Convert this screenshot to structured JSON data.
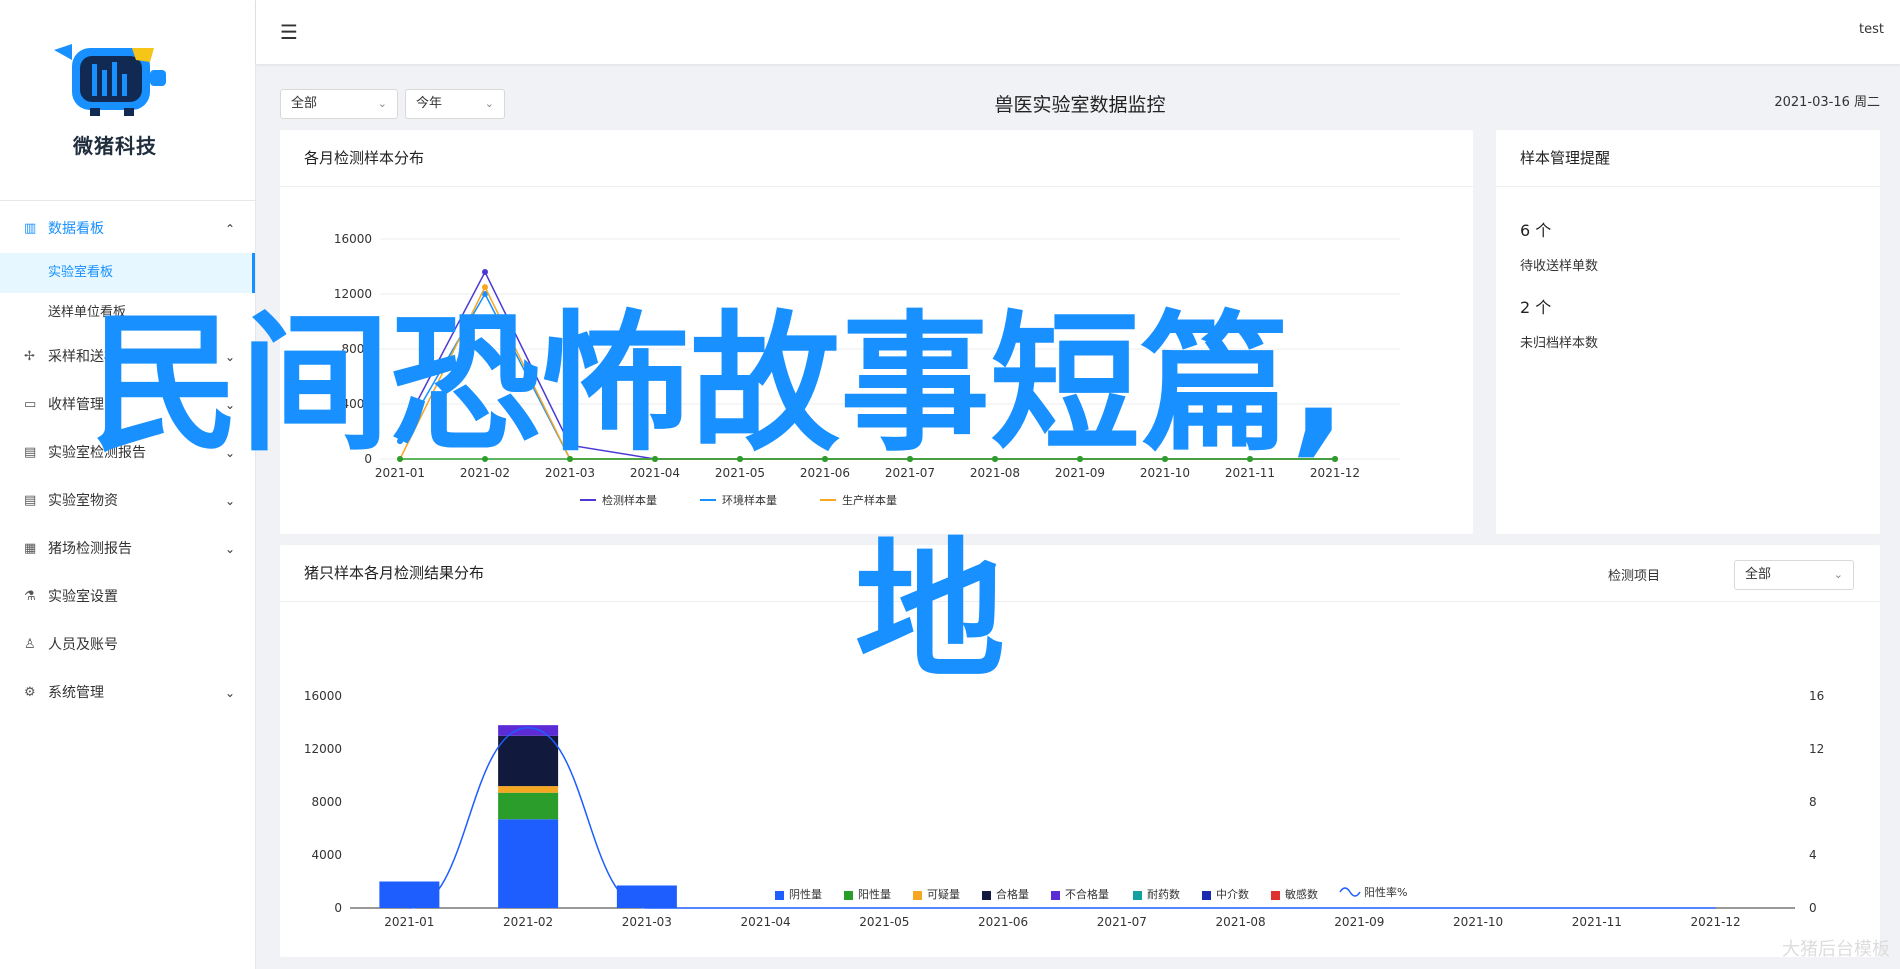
{
  "brand": {
    "name": "微猪科技",
    "colors": {
      "primary": "#1890ff",
      "dark": "#102a54",
      "yellow": "#f5c518"
    }
  },
  "sidebar": {
    "groups": [
      {
        "label": "数据看板",
        "icon": "bar-chart-icon",
        "open": true,
        "children": [
          {
            "label": "实验室看板",
            "active": true
          },
          {
            "label": "送样单位看板"
          }
        ]
      },
      {
        "label": "采样和送样",
        "icon": "sample-icon",
        "chevron": true
      },
      {
        "label": "收样管理",
        "icon": "inbox-icon",
        "chevron": true
      },
      {
        "label": "实验室检测报告",
        "icon": "report-icon",
        "chevron": true
      },
      {
        "label": "实验室物资",
        "icon": "supplies-icon",
        "chevron": true
      },
      {
        "label": "猪场检测报告",
        "icon": "farm-report-icon",
        "chevron": true
      },
      {
        "label": "实验室设置",
        "icon": "lab-settings-icon",
        "chevron": false
      },
      {
        "label": "人员及账号",
        "icon": "user-icon",
        "chevron": false
      },
      {
        "label": "系统管理",
        "icon": "gear-icon",
        "chevron": true
      }
    ]
  },
  "header": {
    "user": "test"
  },
  "toolbar": {
    "filter1": "全部",
    "filter2": "今年",
    "title": "兽医实验室数据监控",
    "date": "2021-03-16 周二"
  },
  "card_monthly": {
    "title": "各月检测样本分布"
  },
  "card_remind": {
    "title": "样本管理提醒",
    "items": [
      {
        "num": "6 个",
        "label": "待收送样单数"
      },
      {
        "num": "2 个",
        "label": "未归档样本数"
      }
    ]
  },
  "card_pig": {
    "title": "猪只样本各月检测结果分布",
    "filter_label": "检测项目",
    "filter_value": "全部"
  },
  "overlay": {
    "line1": "民间恐怖故事短篇,",
    "line2": "地"
  },
  "watermark": "大猪后台模板",
  "chart_data": [
    {
      "type": "line",
      "title": "各月检测样本分布",
      "x": [
        "2021-01",
        "2021-02",
        "2021-03",
        "2021-04",
        "2021-05",
        "2021-06",
        "2021-07",
        "2021-08",
        "2021-09",
        "2021-10",
        "2021-11",
        "2021-12"
      ],
      "ylim": [
        0,
        16000
      ],
      "yticks": [
        0,
        4000,
        8000,
        12000,
        16000
      ],
      "series": [
        {
          "name": "检测样本量",
          "color": "#4a3ad3",
          "values": [
            1800,
            13600,
            1000,
            0,
            0,
            0,
            0,
            0,
            0,
            0,
            0,
            0
          ]
        },
        {
          "name": "环境样本量",
          "color": "#1890ff",
          "values": [
            1300,
            12000,
            0,
            0,
            0,
            0,
            0,
            0,
            0,
            0,
            0,
            0
          ]
        },
        {
          "name": "生产样本量",
          "color": "#f5a623",
          "values": [
            0,
            12500,
            0,
            0,
            0,
            0,
            0,
            0,
            0,
            0,
            0,
            0
          ]
        },
        {
          "name": "",
          "color": "#2a9d2a",
          "values": [
            0,
            0,
            0,
            0,
            0,
            0,
            0,
            0,
            0,
            0,
            0,
            0
          ]
        }
      ]
    },
    {
      "type": "bar",
      "title": "猪只样本各月检测结果分布",
      "categories": [
        "2021-01",
        "2021-02",
        "2021-03",
        "2021-04",
        "2021-05",
        "2021-06",
        "2021-07",
        "2021-08",
        "2021-09",
        "2021-10",
        "2021-11",
        "2021-12"
      ],
      "ylim": [
        0,
        16000
      ],
      "yticks": [
        0,
        4000,
        8000,
        12000,
        16000
      ],
      "y2lim": [
        0,
        16
      ],
      "y2ticks": [
        0,
        4,
        8,
        12,
        16
      ],
      "stacked": true,
      "series": [
        {
          "name": "阴性量",
          "color": "#1e5eff",
          "values": [
            2000,
            6700,
            1700,
            0,
            0,
            0,
            0,
            0,
            0,
            0,
            0,
            0
          ]
        },
        {
          "name": "阳性量",
          "color": "#2a9d2a",
          "values": [
            0,
            2000,
            0,
            0,
            0,
            0,
            0,
            0,
            0,
            0,
            0,
            0
          ]
        },
        {
          "name": "可疑量",
          "color": "#f5a623",
          "values": [
            0,
            500,
            0,
            0,
            0,
            0,
            0,
            0,
            0,
            0,
            0,
            0
          ]
        },
        {
          "name": "合格量",
          "color": "#11193d",
          "values": [
            0,
            3800,
            0,
            0,
            0,
            0,
            0,
            0,
            0,
            0,
            0,
            0
          ]
        },
        {
          "name": "不合格量",
          "color": "#5b2bd6",
          "values": [
            0,
            800,
            0,
            0,
            0,
            0,
            0,
            0,
            0,
            0,
            0,
            0
          ]
        },
        {
          "name": "耐药数",
          "color": "#14a0a0",
          "values": [
            0,
            0,
            0,
            0,
            0,
            0,
            0,
            0,
            0,
            0,
            0,
            0
          ]
        },
        {
          "name": "中介数",
          "color": "#1a2bb0",
          "values": [
            0,
            0,
            0,
            0,
            0,
            0,
            0,
            0,
            0,
            0,
            0,
            0
          ]
        },
        {
          "name": "敏感数",
          "color": "#e03030",
          "values": [
            0,
            0,
            0,
            0,
            0,
            0,
            0,
            0,
            0,
            0,
            0,
            0
          ]
        }
      ],
      "line": {
        "name": "阳性率%",
        "color": "#1e5eff",
        "axis": "right",
        "values": [
          0,
          13.6,
          0,
          0,
          0,
          0,
          0,
          0,
          0,
          0,
          0,
          0
        ]
      },
      "legend": "bottom"
    }
  ]
}
